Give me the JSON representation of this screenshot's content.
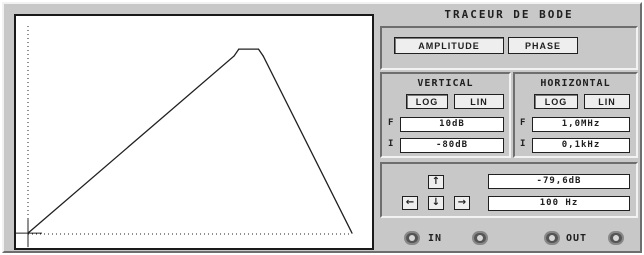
{
  "title": "TRACEUR DE BODE",
  "mode_tabs": [
    "AMPLITUDE",
    "PHASE"
  ],
  "vertical": {
    "label": "VERTICAL",
    "scale_buttons": [
      "LOG",
      "LIN"
    ],
    "final_prefix": "F",
    "final_value": "10dB",
    "initial_prefix": "I",
    "initial_value": "-80dB"
  },
  "horizontal": {
    "label": "HORIZONTAL",
    "scale_buttons": [
      "LOG",
      "LIN"
    ],
    "final_prefix": "F",
    "final_value": "1,0MHz",
    "initial_prefix": "I",
    "initial_value": "0,1kHz"
  },
  "cursor": {
    "readout_value": "-79,6dB",
    "readout_freq": "100 Hz",
    "arrows": [
      "↑",
      "←",
      "↓",
      "→"
    ]
  },
  "connectors": {
    "in_label": "IN",
    "out_label": "OUT"
  },
  "colors": {
    "background": "#c8c8c8",
    "plot_bg": "#ffffff",
    "trace": "#202020"
  },
  "chart_data": {
    "type": "line",
    "title": "",
    "xlabel": "",
    "ylabel": "",
    "x_scale": "log",
    "xlim": [
      100,
      1000000
    ],
    "ylim": [
      -80,
      10
    ],
    "grid": false,
    "series": [
      {
        "values": [
          {
            "x": 100,
            "y": -79.6
          },
          {
            "x": 35000,
            "y": -3
          },
          {
            "x": 40000,
            "y": 0
          },
          {
            "x": 70000,
            "y": 0
          },
          {
            "x": 80000,
            "y": -3
          },
          {
            "x": 1000000,
            "y": -79.6
          }
        ]
      }
    ],
    "cursor": {
      "x": 100,
      "y": -79.6
    }
  }
}
